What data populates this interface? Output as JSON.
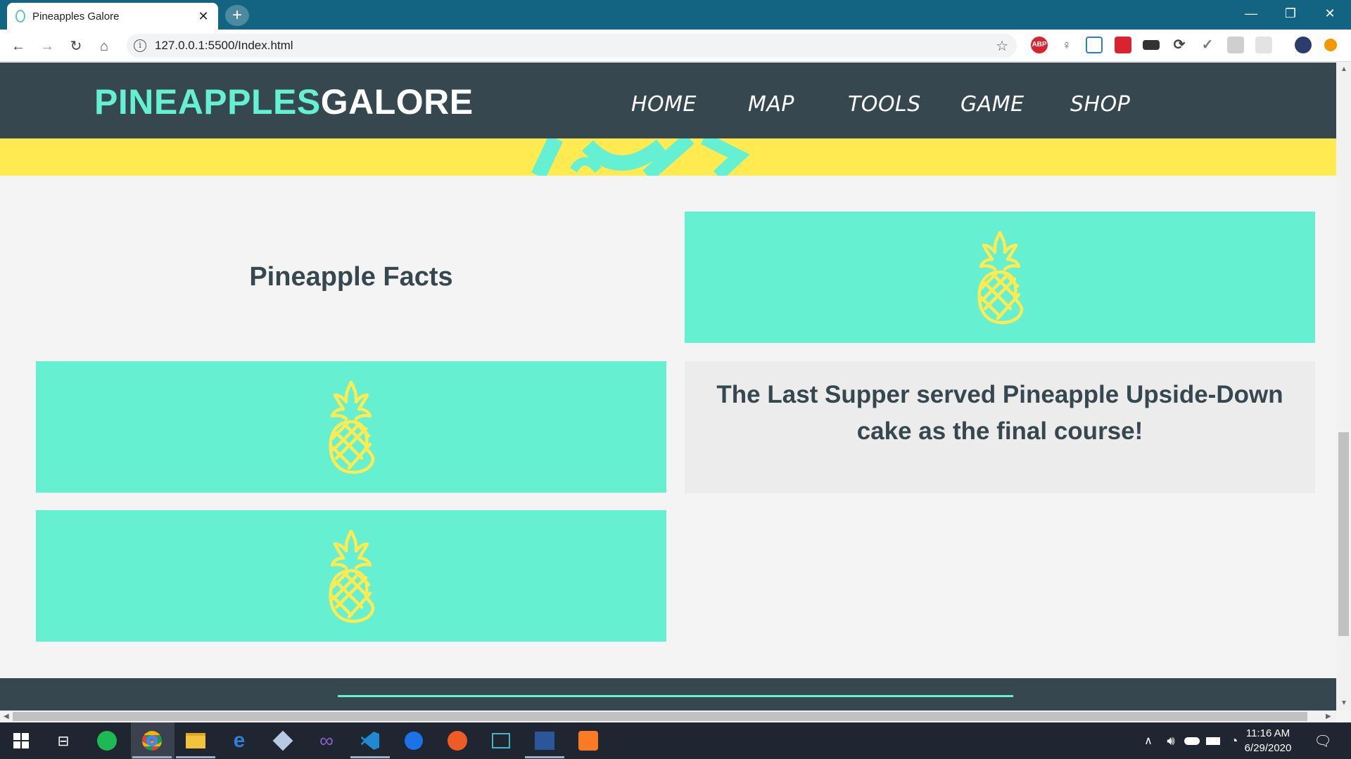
{
  "browser": {
    "tab_title": "Pineapples Galore",
    "tab_close": "✕",
    "new_tab": "+",
    "url": "127.0.0.1:5500/Index.html",
    "window_controls": [
      "—",
      "❐",
      "✕"
    ]
  },
  "site": {
    "logo_part1": "PINEAPPLES",
    "logo_part2": "GALORE",
    "nav": [
      "HOME",
      "MAP",
      "TOOLS",
      "GAME",
      "SHOP"
    ],
    "facts_title": "Pineapple Facts",
    "fact_text": "The Last Supper served Pineapple Upside-Down cake as the final course!"
  },
  "colors": {
    "header": "#37474f",
    "accent": "#64f0d2",
    "banner": "#ffeb4f",
    "pineapple_icon": "#ffeb4f"
  },
  "extensions": [
    "abp-icon",
    "lightbulb-icon",
    "screenshot-icon",
    "pdf-icon",
    "fullscreen-icon",
    "sync-icon",
    "check-icon",
    "k-icon",
    "settings-icon",
    "profile-avatar",
    "update-icon"
  ],
  "extension_labels": {
    "abp": "ABP"
  },
  "taskbar": {
    "clock_time": "11:16 AM",
    "clock_date": "6/29/2020"
  }
}
